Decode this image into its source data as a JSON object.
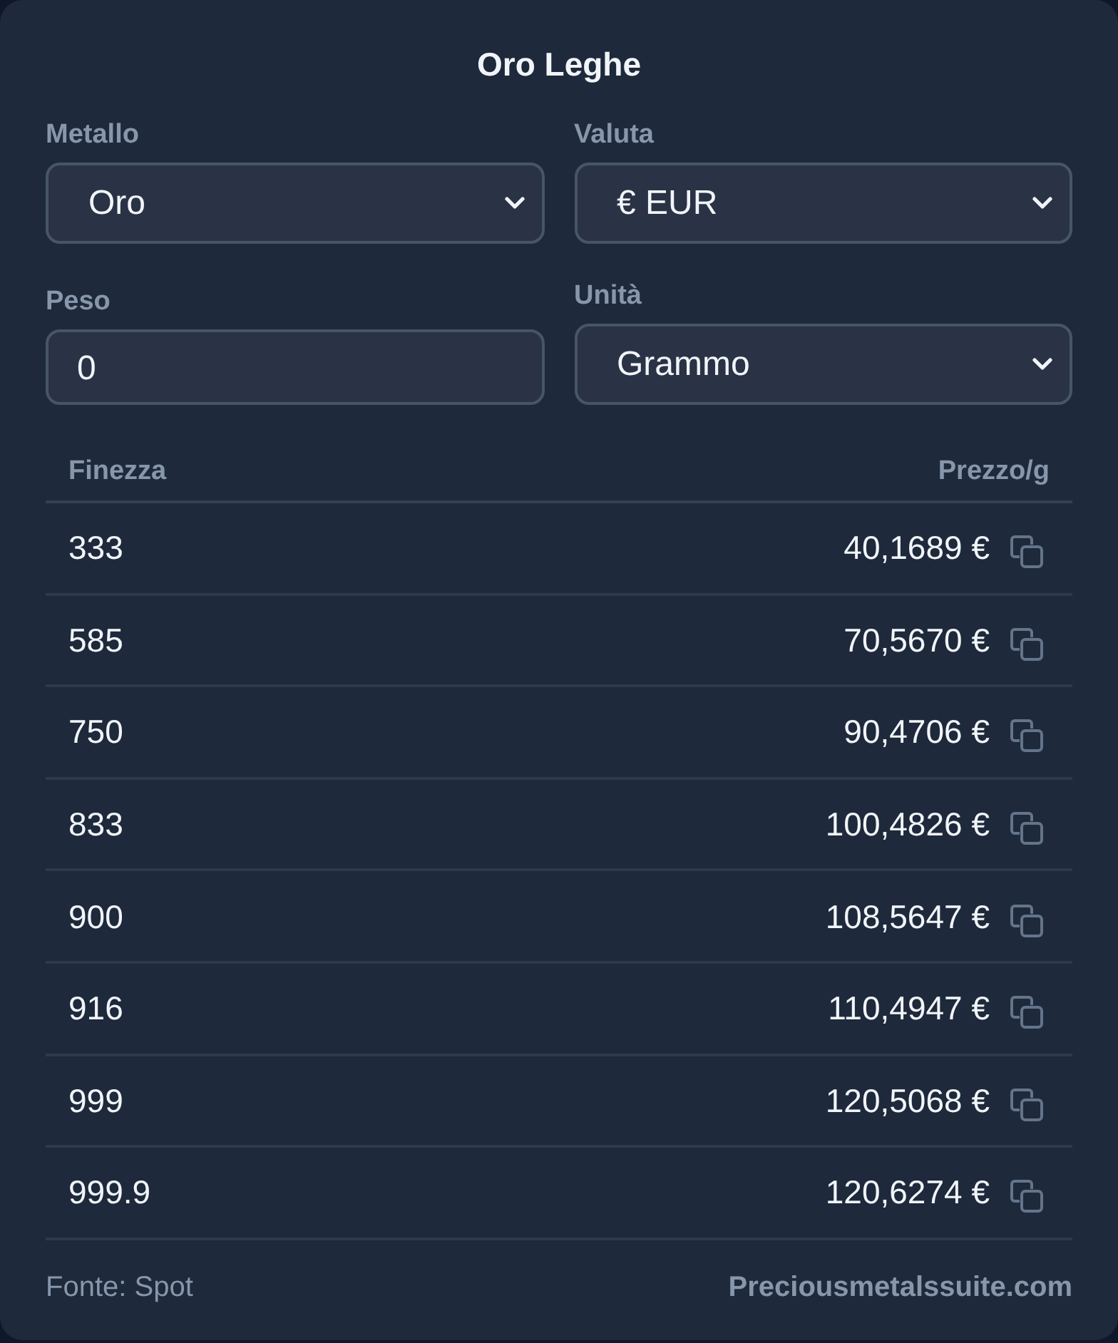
{
  "title": "Oro Leghe",
  "fields": [
    {
      "label": "Metallo",
      "kind": "select",
      "value": "Oro"
    },
    {
      "label": "Valuta",
      "kind": "select",
      "value": "€ EUR"
    },
    {
      "label": "Peso",
      "kind": "input",
      "value": "0"
    },
    {
      "label": "Unità",
      "kind": "select",
      "value": "Grammo"
    }
  ],
  "table": {
    "columns": [
      "Finezza",
      "Prezzo/g"
    ],
    "rows": [
      {
        "fineness": "333",
        "price": "40,1689 €"
      },
      {
        "fineness": "585",
        "price": "70,5670 €"
      },
      {
        "fineness": "750",
        "price": "90,4706 €"
      },
      {
        "fineness": "833",
        "price": "100,4826 €"
      },
      {
        "fineness": "900",
        "price": "108,5647 €"
      },
      {
        "fineness": "916",
        "price": "110,4947 €"
      },
      {
        "fineness": "999",
        "price": "120,5068 €"
      },
      {
        "fineness": "999.9",
        "price": "120,6274 €"
      }
    ]
  },
  "footer": {
    "source": "Fonte: Spot",
    "link": "Preciousmetalssuite.com"
  }
}
